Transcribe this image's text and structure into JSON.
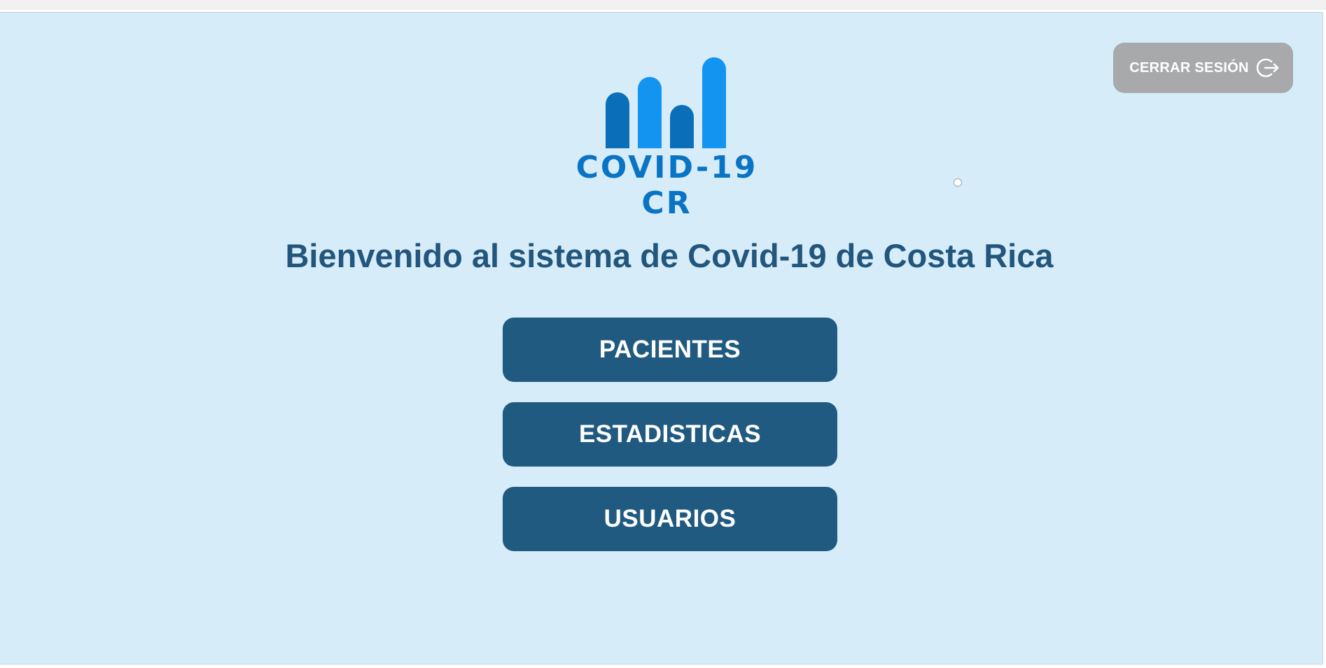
{
  "header": {
    "logout_label": "CERRAR SESIÓN",
    "logout_icon": "logout-icon"
  },
  "logo": {
    "text": "COVID-19 CR",
    "icon": "bar-chart-icon",
    "colors": [
      "#0a6fb8",
      "#1294f0"
    ]
  },
  "main": {
    "title": "Bienvenido al sistema de Covid-19 de Costa Rica",
    "menu": [
      {
        "label": "PACIENTES"
      },
      {
        "label": "ESTADISTICAS"
      },
      {
        "label": "USUARIOS"
      }
    ]
  },
  "colors": {
    "background": "#d7ecf9",
    "button": "#215a80",
    "title": "#22567d",
    "logout": "#a7a9ab"
  }
}
